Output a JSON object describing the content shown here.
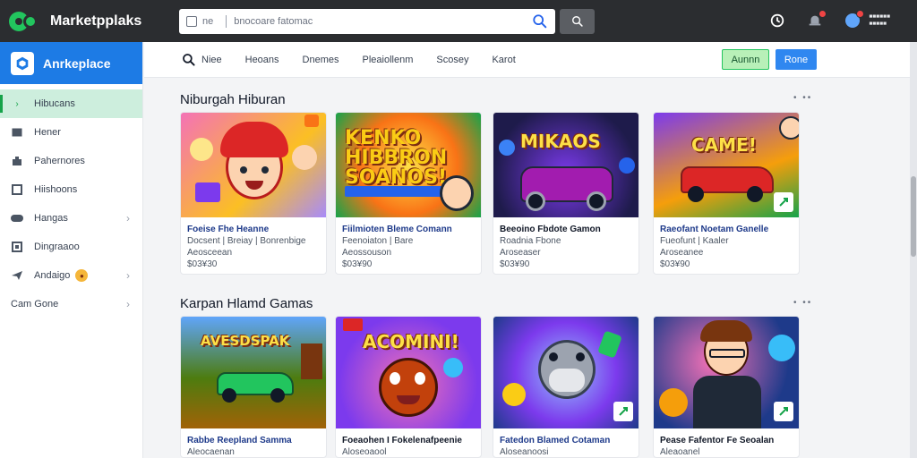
{
  "topbar": {
    "brand": "Marketpplaks",
    "search_prefix": "ne",
    "search_value": "bnocoare fatomac"
  },
  "sidebar": {
    "title": "Anrkeplace",
    "items": [
      {
        "label": "Hibucans",
        "icon": "chevron-right-icon"
      },
      {
        "label": "Hener",
        "icon": "card-icon"
      },
      {
        "label": "Pahernores",
        "icon": "puzzle-icon"
      },
      {
        "label": "Hiishoons",
        "icon": "square-icon"
      },
      {
        "label": "Hangas",
        "icon": "gamepad-icon"
      },
      {
        "label": "Dingraaoo",
        "icon": "box-icon"
      },
      {
        "label": "Andaigo",
        "icon": "plane-icon"
      },
      {
        "label": "Cam Gone",
        "icon": ""
      }
    ]
  },
  "main_header": {
    "tabs": [
      "Niee",
      "Heoans",
      "Dnemes",
      "Pleaiollenm",
      "Scosey",
      "Karot"
    ],
    "btn_green": "Aunnn",
    "btn_blue": "Rone"
  },
  "sections": [
    {
      "title": "Niburgah Hiburan",
      "cards": [
        {
          "title": "Foeise Fhe Heanne",
          "sub": "Docsent | Breiay | Bonrenbige",
          "sub2": "Aeosceean",
          "price": "$03¥30",
          "art": ""
        },
        {
          "title": "Fiilmioten Bleme Comann",
          "sub": "Feenoiaton | Bare",
          "sub2": "Aeossouson",
          "price": "$03¥90",
          "art": "KENKO HIBBRON SOANOS!"
        },
        {
          "title": "Beeoino Fbdote Gamon",
          "sub": "Roadnia Fbone",
          "sub2": "Aroseaser",
          "price": "$03¥90",
          "art": "MIKAOS"
        },
        {
          "title": "Raeofant Noetam Ganelle",
          "sub": "Fueofunt | Kaaler",
          "sub2": "Aroseanee",
          "price": "$03¥90",
          "art": "CAME!"
        }
      ]
    },
    {
      "title": "Karpan Hlamd Gamas",
      "cards": [
        {
          "title": "Rabbe Reepland Samma",
          "sub": "Aleocaenan",
          "price": "",
          "art": "AVESDSPAK"
        },
        {
          "title": "Foeaohen I Fokelenafpeenie",
          "sub": "Aloseoaool",
          "price": "",
          "art": "ACOMINI!"
        },
        {
          "title": "Fatedon Blamed Cotaman",
          "sub": "Aloseanoosi",
          "price": "",
          "art": ""
        },
        {
          "title": "Pease Fafentor Fe Seoalan",
          "sub": "Aleaoanel",
          "price": "",
          "art": ""
        }
      ]
    }
  ]
}
